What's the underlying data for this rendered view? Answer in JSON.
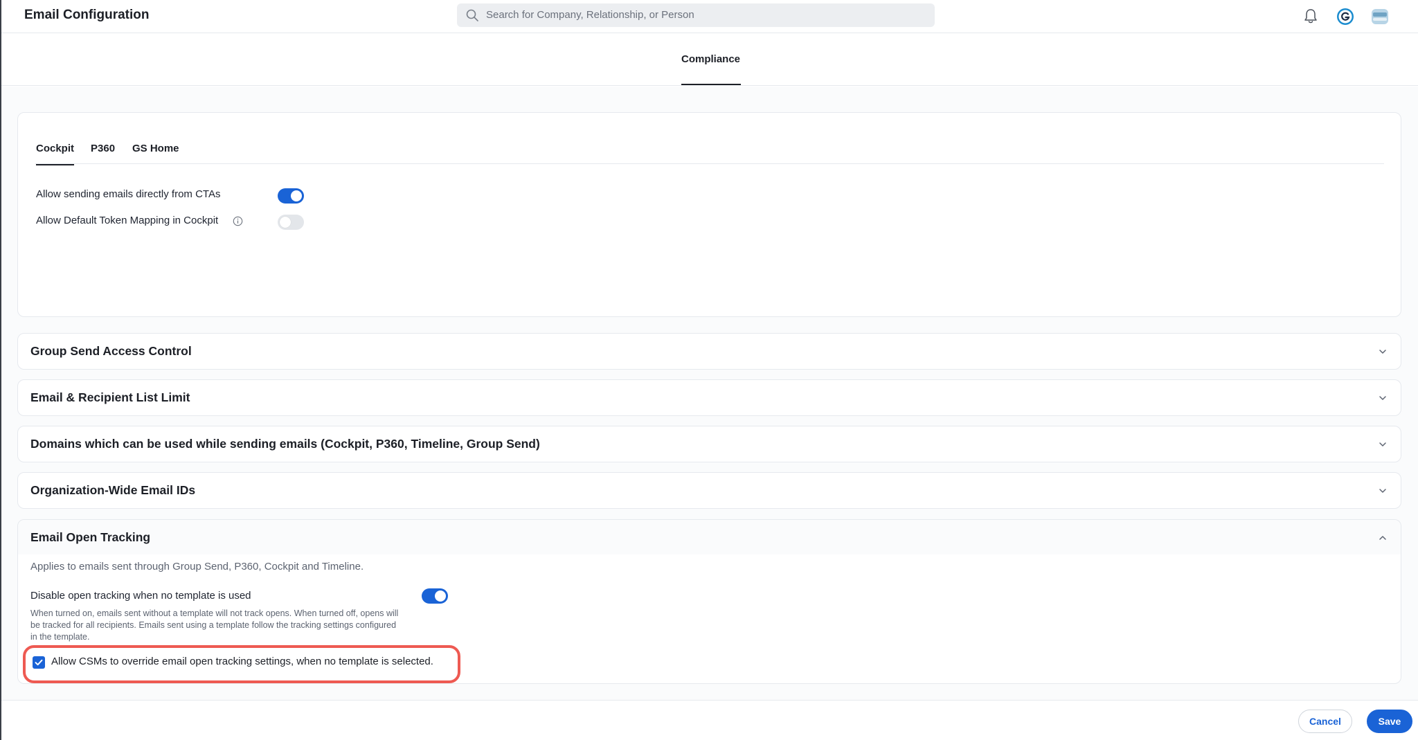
{
  "header": {
    "title": "Email Configuration",
    "search_placeholder": "Search for Company, Relationship, or Person"
  },
  "top_tabs": [
    {
      "label": "Compliance",
      "active": true
    }
  ],
  "cockpit_panel": {
    "subtabs": [
      {
        "label": "Cockpit",
        "active": true
      },
      {
        "label": "P360",
        "active": false
      },
      {
        "label": "GS Home",
        "active": false
      }
    ],
    "settings": [
      {
        "label": "Allow sending emails directly from CTAs",
        "enabled": true
      },
      {
        "label": "Allow Default Token Mapping in Cockpit",
        "enabled": false,
        "info": true
      }
    ]
  },
  "sections": [
    {
      "title": "Group Send Access Control",
      "expanded": false
    },
    {
      "title": "Email & Recipient List Limit",
      "expanded": false
    },
    {
      "title": "Domains which can be used while sending emails (Cockpit, P360, Timeline, Group Send)",
      "expanded": false
    },
    {
      "title": "Organization-Wide Email IDs",
      "expanded": false
    }
  ],
  "open_tracking": {
    "title": "Email Open Tracking",
    "expanded": true,
    "description": "Applies to emails sent through Group Send, P360, Cockpit and Timeline.",
    "option_label": "Disable open tracking when no template is used",
    "option_enabled": true,
    "option_help": "When turned on, emails sent without a template will not track opens. When turned off, opens will be tracked for all recipients. Emails sent using a template follow the tracking settings configured in the template.",
    "checkbox_label": "Allow CSMs to override email open tracking settings, when no template is selected.",
    "checkbox_checked": true
  },
  "footer": {
    "cancel_label": "Cancel",
    "save_label": "Save"
  },
  "colors": {
    "accent": "#1a63d6",
    "highlight": "#ee5a52"
  }
}
